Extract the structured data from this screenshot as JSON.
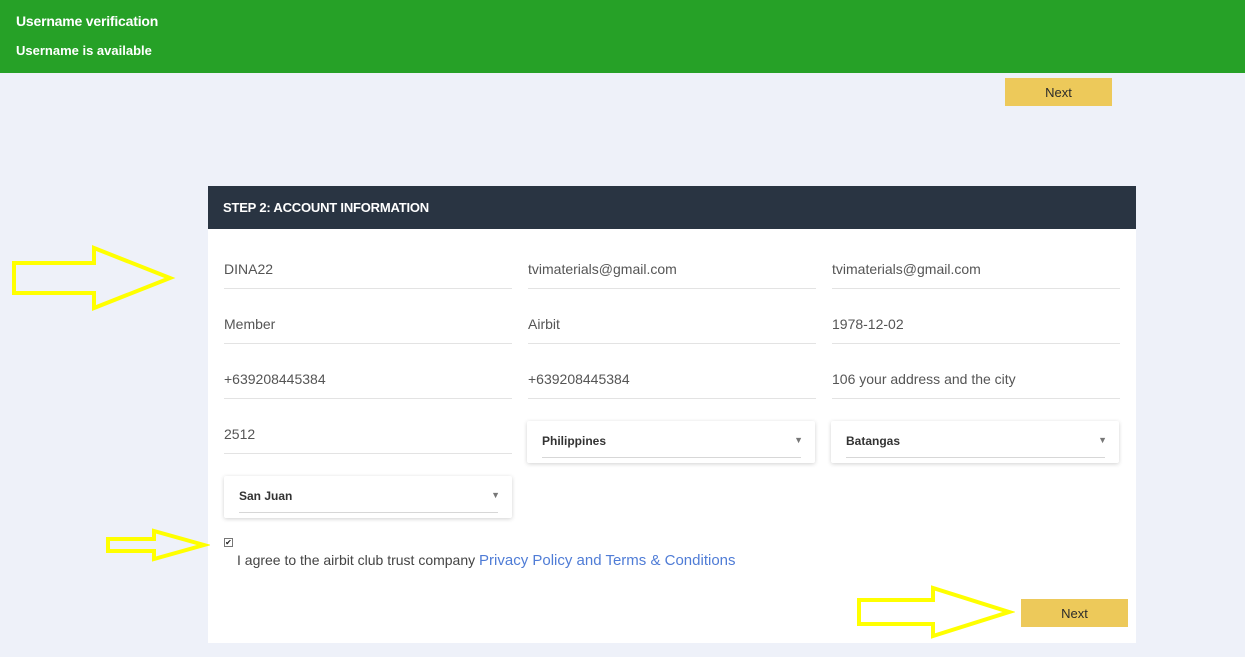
{
  "banner": {
    "title": "Username verification",
    "message": "Username is available"
  },
  "top_next_label": "Next",
  "bottom_next_label": "Next",
  "section_title": "STEP 2: ACCOUNT INFORMATION",
  "fields": {
    "username": "DINA22",
    "email": "tvimaterials@gmail.com",
    "email_confirm": "tvimaterials@gmail.com",
    "first_name": "Member",
    "last_name": "Airbit",
    "birthdate": "1978-12-02",
    "phone": "+639208445384",
    "phone_confirm": "+639208445384",
    "address": "106 your address and the city",
    "zip": "2512"
  },
  "selects": {
    "country": "Philippines",
    "province": "Batangas",
    "city": "San Juan"
  },
  "agreement": {
    "text": "I agree to the airbit club trust company",
    "link": "Privacy Policy and Terms & Conditions",
    "checked": true
  },
  "colors": {
    "banner_green": "#26a127",
    "header_navy": "#293442",
    "button_yellow": "#edc95a",
    "arrow_yellow": "#ffff00",
    "link_blue": "#4f7cd6"
  }
}
